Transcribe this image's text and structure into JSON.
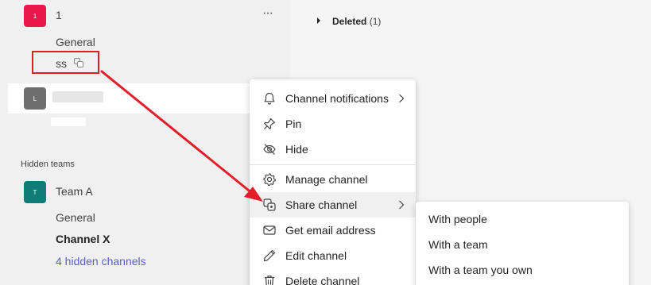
{
  "sidebar": {
    "team1": {
      "avatar": "1",
      "name": "1",
      "more": "···",
      "avatar_color": "#e8184a"
    },
    "team1_channels": [
      {
        "label": "General"
      },
      {
        "label": "ss"
      }
    ],
    "team2": {
      "avatar": "L",
      "avatar_color": "#6e6e6e"
    },
    "hidden_header": "Hidden teams",
    "teamA": {
      "avatar": "T",
      "name": "Team A",
      "avatar_color": "#0f7c78"
    },
    "teamA_channels": [
      {
        "label": "General"
      },
      {
        "label": "Channel X"
      }
    ],
    "hidden_link": "4 hidden channels"
  },
  "main": {
    "deleted_label": "Deleted",
    "deleted_count": "(1)"
  },
  "context_menu": {
    "items": [
      {
        "label": "Channel notifications",
        "icon": "bell-icon",
        "submenu": true
      },
      {
        "label": "Pin",
        "icon": "pin-icon"
      },
      {
        "label": "Hide",
        "icon": "hide-icon"
      },
      {
        "label": "Manage channel",
        "icon": "gear-icon"
      },
      {
        "label": "Share channel",
        "icon": "share-icon",
        "submenu": true,
        "highlighted": true
      },
      {
        "label": "Get email address",
        "icon": "mail-icon"
      },
      {
        "label": "Edit channel",
        "icon": "pencil-icon"
      },
      {
        "label": "Delete channel",
        "icon": "trash-icon"
      }
    ]
  },
  "share_submenu": {
    "items": [
      {
        "label": "With people"
      },
      {
        "label": "With a team"
      },
      {
        "label": "With a team you own"
      }
    ]
  },
  "colors": {
    "highlight": "#ffffff",
    "annotation": "#e11d2a",
    "link": "#5b5fc7",
    "menu_hover": "#f0f0f0"
  }
}
